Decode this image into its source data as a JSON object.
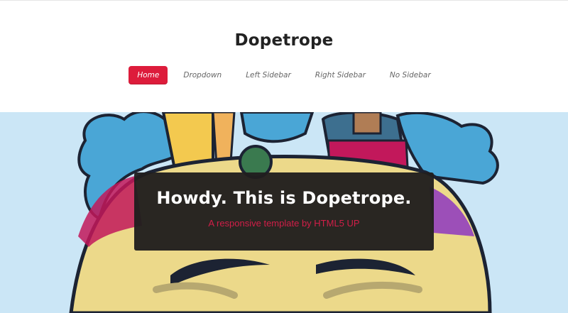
{
  "site": {
    "title": "Dopetrope"
  },
  "nav": {
    "items": [
      {
        "label": "Home",
        "active": true
      },
      {
        "label": "Dropdown",
        "active": false
      },
      {
        "label": "Left Sidebar",
        "active": false
      },
      {
        "label": "Right Sidebar",
        "active": false
      },
      {
        "label": "No Sidebar",
        "active": false
      }
    ]
  },
  "banner": {
    "heading": "Howdy. This is Dopetrope.",
    "subheading": "A responsive template by HTML5 UP"
  },
  "colors": {
    "accent": "#dd1c3b",
    "banner_bg": "#cbe6f6",
    "caption_bg": "#201e1e"
  }
}
